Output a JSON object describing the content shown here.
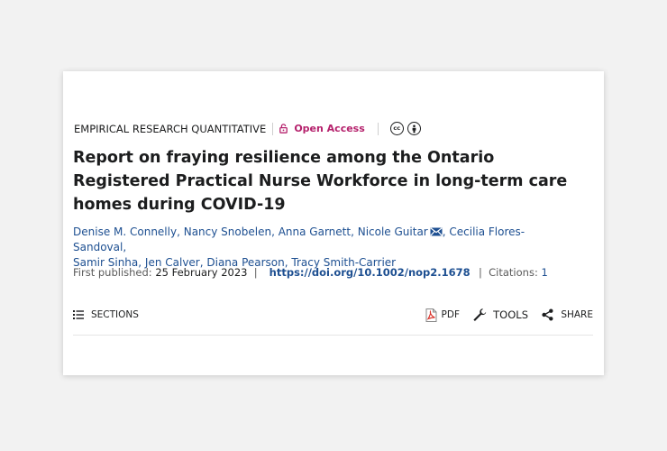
{
  "article": {
    "type_label": "EMPIRICAL RESEARCH QUANTITATIVE",
    "access_label": "Open Access",
    "license_icons": [
      "cc-icon",
      "by-icon"
    ],
    "title": "Report on fraying resilience among the Ontario Registered Practical Nurse Workforce in long-term care homes during COVID-19",
    "authors": [
      "Denise M. Connelly",
      "Nancy Snobelen",
      "Anna Garnett",
      "Nicole Guitar",
      "Cecilia Flores-Sandoval",
      "Samir Sinha",
      "Jen Calver",
      "Diana Pearson",
      "Tracy Smith-Carrier"
    ],
    "first_published_label": "First published:",
    "first_published_date": "25 February 2023",
    "doi": "https://doi.org/10.1002/nop2.1678",
    "citations_label": "Citations:",
    "citations_count": "1"
  },
  "toolbar": {
    "sections_label": "SECTIONS",
    "pdf_label": "PDF",
    "tools_label": "TOOLS",
    "share_label": "SHARE"
  },
  "colors": {
    "access": "#b5216c",
    "link": "#1d4f91",
    "background": "#f2f2f2"
  }
}
